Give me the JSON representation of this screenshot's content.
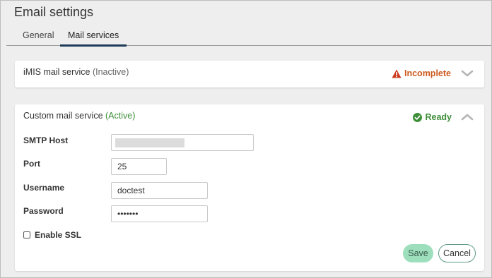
{
  "page": {
    "title": "Email settings"
  },
  "tabs": {
    "general": "General",
    "mail_services": "Mail services"
  },
  "imis": {
    "name": "iMIS mail service",
    "state": "(Inactive)",
    "status": "Incomplete"
  },
  "custom": {
    "name": "Custom mail service",
    "state": "(Active)",
    "status": "Ready",
    "fields": {
      "smtp_label": "SMTP Host",
      "smtp_value": "",
      "port_label": "Port",
      "port_value": "25",
      "username_label": "Username",
      "username_value": "doctest",
      "password_label": "Password",
      "password_value": "•••••••",
      "ssl_label": "Enable SSL"
    },
    "buttons": {
      "save": "Save",
      "cancel": "Cancel"
    }
  },
  "colors": {
    "incomplete": "#cc5a1e",
    "ready": "#3f8f3a",
    "tab_underline": "#1d3a59",
    "save_button": "#9ddfbd"
  },
  "icons": {
    "incomplete": "warning-triangle-icon",
    "ready": "check-circle-icon",
    "collapse": "chevron-up-icon",
    "expand": "chevron-down-icon"
  }
}
